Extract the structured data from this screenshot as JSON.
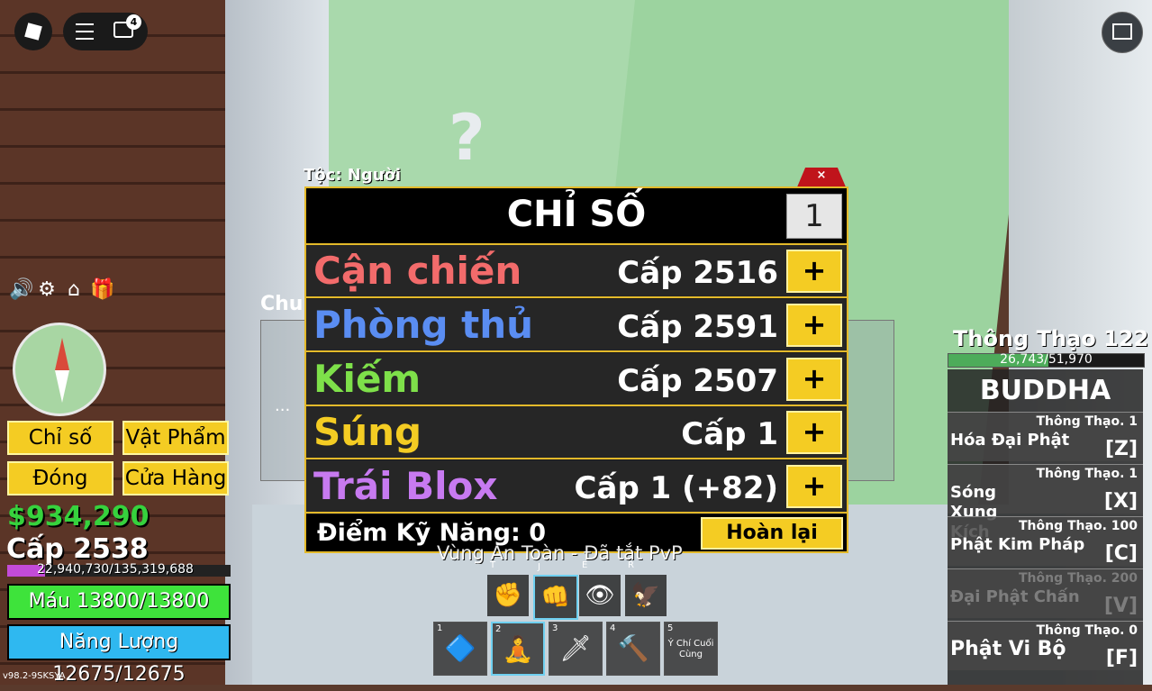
{
  "top_bar": {
    "chat_badge": "4"
  },
  "scene": {
    "question_mark": "?",
    "npc_label": "Chu",
    "dots": "..."
  },
  "race": "Tộc: Người",
  "left_menu": {
    "stats_label": "Chỉ số",
    "items_label": "Vật Phẩm",
    "close_label": "Đóng",
    "shop_label": "Cửa Hàng"
  },
  "player": {
    "money": "$934,290",
    "level": "Cấp 2538",
    "xp": "22,940,730/135,319,688",
    "xp_fraction": 0.17,
    "health": "Máu 13800/13800",
    "health_fraction": 1.0,
    "energy": "Năng Lượng 12675/12675",
    "energy_fraction": 1.0
  },
  "version": "v98.2-9SKSYA",
  "stats_panel": {
    "title": "CHỈ SỐ",
    "quantity": "1",
    "close": "×",
    "rows": [
      {
        "name": "Cận chiến",
        "level": "Cấp 2516",
        "color": "#f26b6b"
      },
      {
        "name": "Phòng thủ",
        "level": "Cấp 2591",
        "color": "#5a8df2"
      },
      {
        "name": "Kiếm",
        "level": "Cấp 2507",
        "color": "#7ee04a"
      },
      {
        "name": "Súng",
        "level": "Cấp 1",
        "color": "#f4cc23"
      },
      {
        "name": "Trái Blox",
        "level": "Cấp 1 (+82)",
        "color": "#c77af0"
      }
    ],
    "plus": "+",
    "skill_points": "Điểm Kỹ Năng: 0",
    "reset": "Hoàn lại"
  },
  "zone": "Vùng An Toàn - Đã tắt PvP",
  "skills": [
    {
      "key": "T",
      "icon": "fist-icon"
    },
    {
      "key": "J",
      "icon": "punch-icon"
    },
    {
      "key": "E",
      "icon": "eye-icon"
    },
    {
      "key": "R",
      "icon": "wing-icon"
    }
  ],
  "inventory": [
    {
      "num": "1",
      "label": ""
    },
    {
      "num": "2",
      "label": ""
    },
    {
      "num": "3",
      "label": ""
    },
    {
      "num": "4",
      "label": ""
    },
    {
      "num": "5",
      "label": "Ý Chí Cuối Cùng"
    }
  ],
  "mastery": {
    "title": "Thông Thạo 122",
    "progress": "26,743/51,970",
    "fraction": 0.51,
    "fruit": "BUDDHA",
    "moves": [
      {
        "req": "Thông Thạo. 1",
        "name": "Hóa Đại Phật",
        "key": "[Z]",
        "locked": false
      },
      {
        "req": "Thông Thạo. 1",
        "name": "Sóng Xung Kích",
        "key": "[X]",
        "locked": false
      },
      {
        "req": "Thông Thạo. 100",
        "name": "Phật Kim Pháp",
        "key": "[C]",
        "locked": false
      },
      {
        "req": "Thông Thạo. 200",
        "name": "Đại Phật Chấn",
        "key": "[V]",
        "locked": true
      },
      {
        "req": "Thông Thạo. 0",
        "name": "Phật Vi Bộ",
        "key": "[F]",
        "locked": false
      }
    ]
  }
}
